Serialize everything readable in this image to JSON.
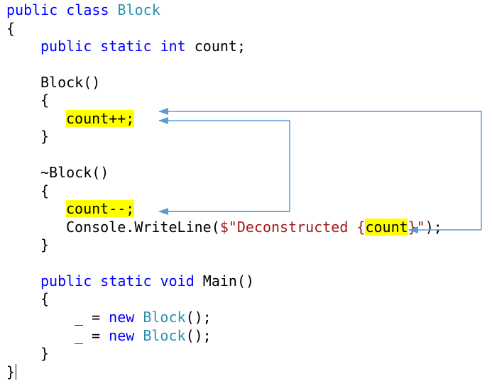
{
  "code": {
    "line1": {
      "kw": "public class ",
      "type": "Block"
    },
    "line2": {
      "text": "{"
    },
    "line3": {
      "kw1": "public static int ",
      "text": "count;"
    },
    "line5": {
      "text": "Block()"
    },
    "line6": {
      "text": "{"
    },
    "line7": {
      "hl": "count++;"
    },
    "line8": {
      "text": "}"
    },
    "line10": {
      "text": "~Block()"
    },
    "line11": {
      "text": "{"
    },
    "line12": {
      "hl": "count--;"
    },
    "line13": {
      "pre": "Console.WriteLine(",
      "str1": "$\"Deconstructed {",
      "hl": "count",
      "str2": "}\"",
      "post": ");"
    },
    "line14": {
      "text": "}"
    },
    "line16": {
      "kw": "public static void ",
      "text": "Main()"
    },
    "line17": {
      "text": "{"
    },
    "line18": {
      "pre": "_ = ",
      "kw": "new ",
      "type": "Block",
      "post": "();"
    },
    "line19": {
      "pre": "_ = ",
      "kw": "new ",
      "type": "Block",
      "post": "();"
    },
    "line20": {
      "text": "}"
    },
    "line21": {
      "text": "}"
    }
  },
  "colors": {
    "keyword": "#0000ff",
    "type": "#2b91af",
    "string": "#a31515",
    "highlight": "#ffff00",
    "arrow": "#5b9bd5"
  }
}
